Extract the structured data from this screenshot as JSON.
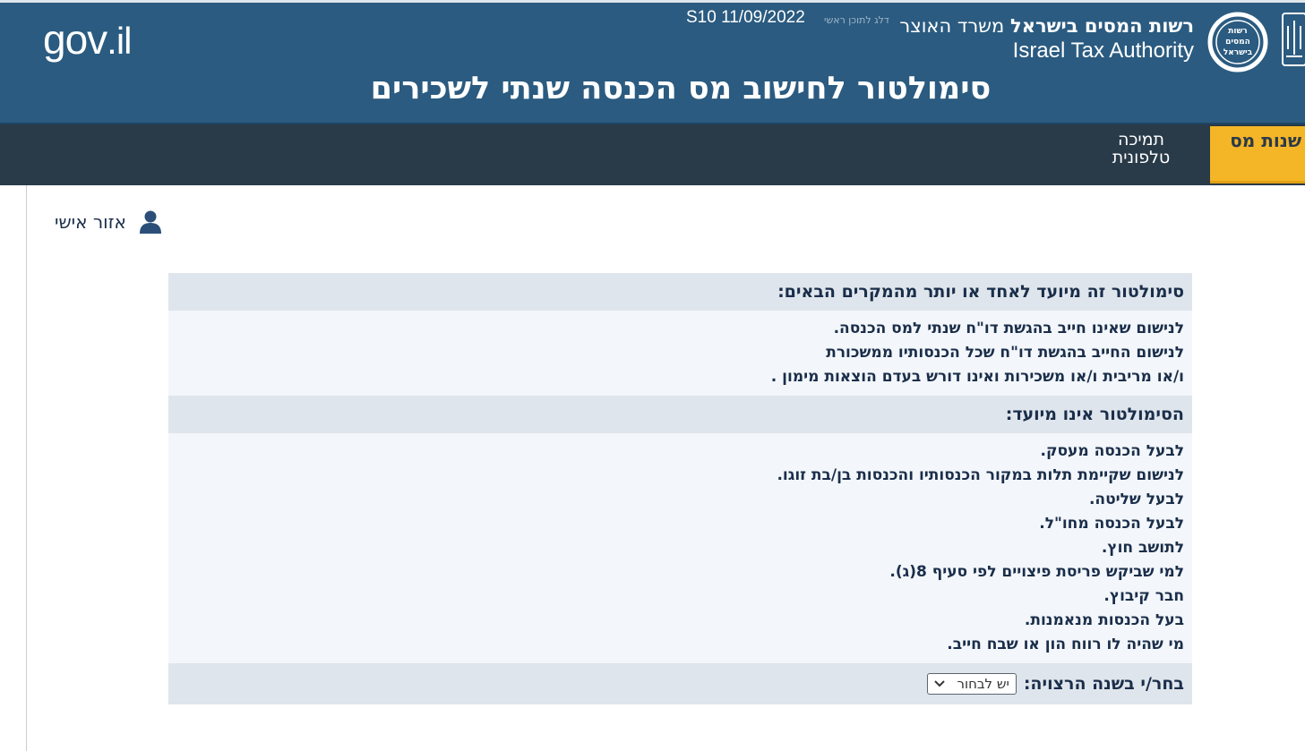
{
  "header": {
    "ita_name_heb_bold": "רשות המסים בישראל",
    "ita_name_heb_normal": " משרד האוצר",
    "ita_name_eng": "Israel Tax Authority",
    "ita_logo_text": [
      "רשות",
      "המסים",
      "בישראל"
    ],
    "skip_link": "דלג לתוכן ראשי",
    "version": "S10 11/09/2022",
    "gov_logo_main": "gov",
    "gov_logo_suffix": ".il",
    "page_title": "סימולטור לחישוב מס הכנסה שנתי לשכירים"
  },
  "nav": {
    "active_tab": "שנות מס",
    "support_line1": "תמיכה",
    "support_line2": "טלפונית"
  },
  "personal_area": {
    "label": "אזור אישי",
    "icon": "user-icon"
  },
  "content": {
    "intended_title": "סימולטור זה מיועד לאחד או יותר מהמקרים הבאים:",
    "intended_items": [
      "לנישום שאינו חייב בהגשת דו\"ח שנתי למס הכנסה.",
      "לנישום החייב בהגשת דו\"ח שכל הכנסותיו ממשכורת",
      "ו/או מריבית ו/או משכירות ואינו דורש בעדם הוצאות מימון ."
    ],
    "not_intended_title": "הסימולטור אינו מיועד:",
    "not_intended_items": [
      "לבעל הכנסה מעסק.",
      "לנישום שקיימת תלות במקור הכנסותיו והכנסות בן/בת זוגו.",
      "לבעל שליטה.",
      "לבעל הכנסה מחו\"ל.",
      "לתושב חוץ.",
      "למי שביקש פריסת פיצויים לפי סעיף 8(ג).",
      "חבר קיבוץ.",
      "בעל הכנסות מנאמנות.",
      "מי שהיה לו רווח הון או שבח חייב."
    ],
    "year_label": "בחר/י בשנה הרצויה:",
    "year_select_value": "יש לבחור"
  },
  "colors": {
    "header_bg": "#2b5b80",
    "nav_bg": "#293a48",
    "active_tab": "#f4b527",
    "band_bg": "#dfe5ec",
    "text": "#1a2e4a"
  }
}
